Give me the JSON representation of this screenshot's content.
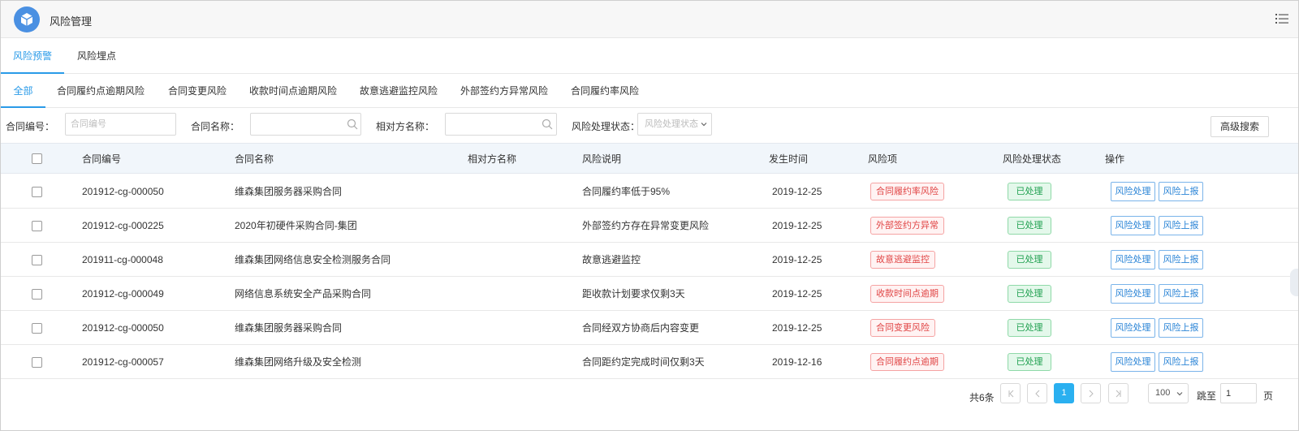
{
  "app": {
    "title": "风险管理"
  },
  "top_tabs": [
    {
      "label": "风险预警",
      "active": true
    },
    {
      "label": "风险埋点",
      "active": false
    }
  ],
  "sub_tabs": [
    {
      "label": "全部",
      "active": true
    },
    {
      "label": "合同履约点逾期风险",
      "active": false
    },
    {
      "label": "合同变更风险",
      "active": false
    },
    {
      "label": "收款时间点逾期风险",
      "active": false
    },
    {
      "label": "故意逃避监控风险",
      "active": false
    },
    {
      "label": "外部签约方异常风险",
      "active": false
    },
    {
      "label": "合同履约率风险",
      "active": false
    }
  ],
  "filters": {
    "contract_no_label": "合同编号：",
    "contract_no_placeholder": "合同编号",
    "contract_name_label": "合同名称：",
    "counterparty_label": "相对方名称：",
    "status_label": "风险处理状态：",
    "status_placeholder": "风险处理状态",
    "advanced_search": "高级搜索"
  },
  "table": {
    "headers": [
      "合同编号",
      "合同名称",
      "相对方名称",
      "风险说明",
      "发生时间",
      "风险项",
      "风险处理状态",
      "操作"
    ],
    "rows": [
      {
        "no": "201912-cg-000050",
        "name": "维森集团服务器采购合同",
        "counterparty": "",
        "desc": "合同履约率低于95%",
        "time": "2019-12-25",
        "risk": "合同履约率风险",
        "status": "已处理",
        "op1": "风险处理",
        "op2": "风险上报"
      },
      {
        "no": "201912-cg-000225",
        "name": "2020年初硬件采购合同-集团",
        "counterparty": "",
        "desc": "外部签约方存在异常变更风险",
        "time": "2019-12-25",
        "risk": "外部签约方异常",
        "status": "已处理",
        "op1": "风险处理",
        "op2": "风险上报"
      },
      {
        "no": "201911-cg-000048",
        "name": "维森集团网络信息安全检测服务合同",
        "counterparty": "",
        "desc": "故意逃避监控",
        "time": "2019-12-25",
        "risk": "故意逃避监控",
        "status": "已处理",
        "op1": "风险处理",
        "op2": "风险上报"
      },
      {
        "no": "201912-cg-000049",
        "name": "网络信息系统安全产品采购合同",
        "counterparty": "",
        "desc": "距收款计划要求仅剩3天",
        "time": "2019-12-25",
        "risk": "收款时间点逾期",
        "status": "已处理",
        "op1": "风险处理",
        "op2": "风险上报"
      },
      {
        "no": "201912-cg-000050",
        "name": "维森集团服务器采购合同",
        "counterparty": "",
        "desc": "合同经双方协商后内容变更",
        "time": "2019-12-25",
        "risk": "合同变更风险",
        "status": "已处理",
        "op1": "风险处理",
        "op2": "风险上报"
      },
      {
        "no": "201912-cg-000057",
        "name": "维森集团网络升级及安全检测",
        "counterparty": "",
        "desc": "合同距约定完成时间仅剩3天",
        "time": "2019-12-16",
        "risk": "合同履约点逾期",
        "status": "已处理",
        "op1": "风险处理",
        "op2": "风险上报"
      }
    ]
  },
  "pager": {
    "total": "共6条",
    "current_page": "1",
    "page_size": "100",
    "jump_label": "跳至",
    "jump_value": "1",
    "page_label": "页"
  },
  "colors": {
    "accent": "#2a9be8",
    "risk_red": "#e04545",
    "ok_green": "#20a050"
  },
  "icons": [
    "cube-logo-icon",
    "list-menu-icon",
    "search-icon",
    "chevron-down-icon",
    "first-page-icon",
    "prev-page-icon",
    "next-page-icon",
    "last-page-icon"
  ]
}
